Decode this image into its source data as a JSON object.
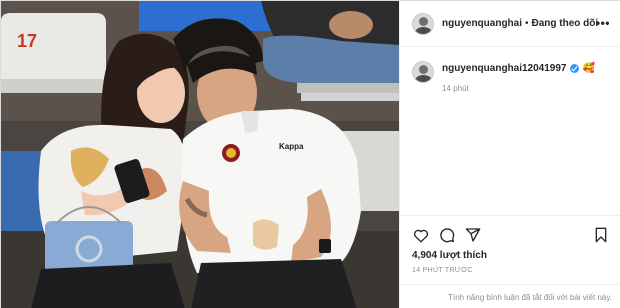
{
  "post": {
    "header": {
      "username": "nguyenquanghai",
      "separator": "•",
      "follow_status": "Đang theo dõi",
      "more_label": "•••"
    },
    "caption": {
      "username": "nguyenquanghai12041997",
      "emoji": "🥰",
      "time": "14 phút"
    },
    "photo": {
      "seat_number": "17",
      "shirt_brand": "Kappa"
    },
    "actions": {
      "like_icon": "heart-icon",
      "comment_icon": "comment-icon",
      "share_icon": "paper-plane-icon",
      "save_icon": "bookmark-icon"
    },
    "likes": "4,904 lượt thích",
    "timestamp": "14 PHÚT TRƯỚC",
    "comments_off": "Tính năng bình luận đã tắt đối với bài viết này."
  }
}
